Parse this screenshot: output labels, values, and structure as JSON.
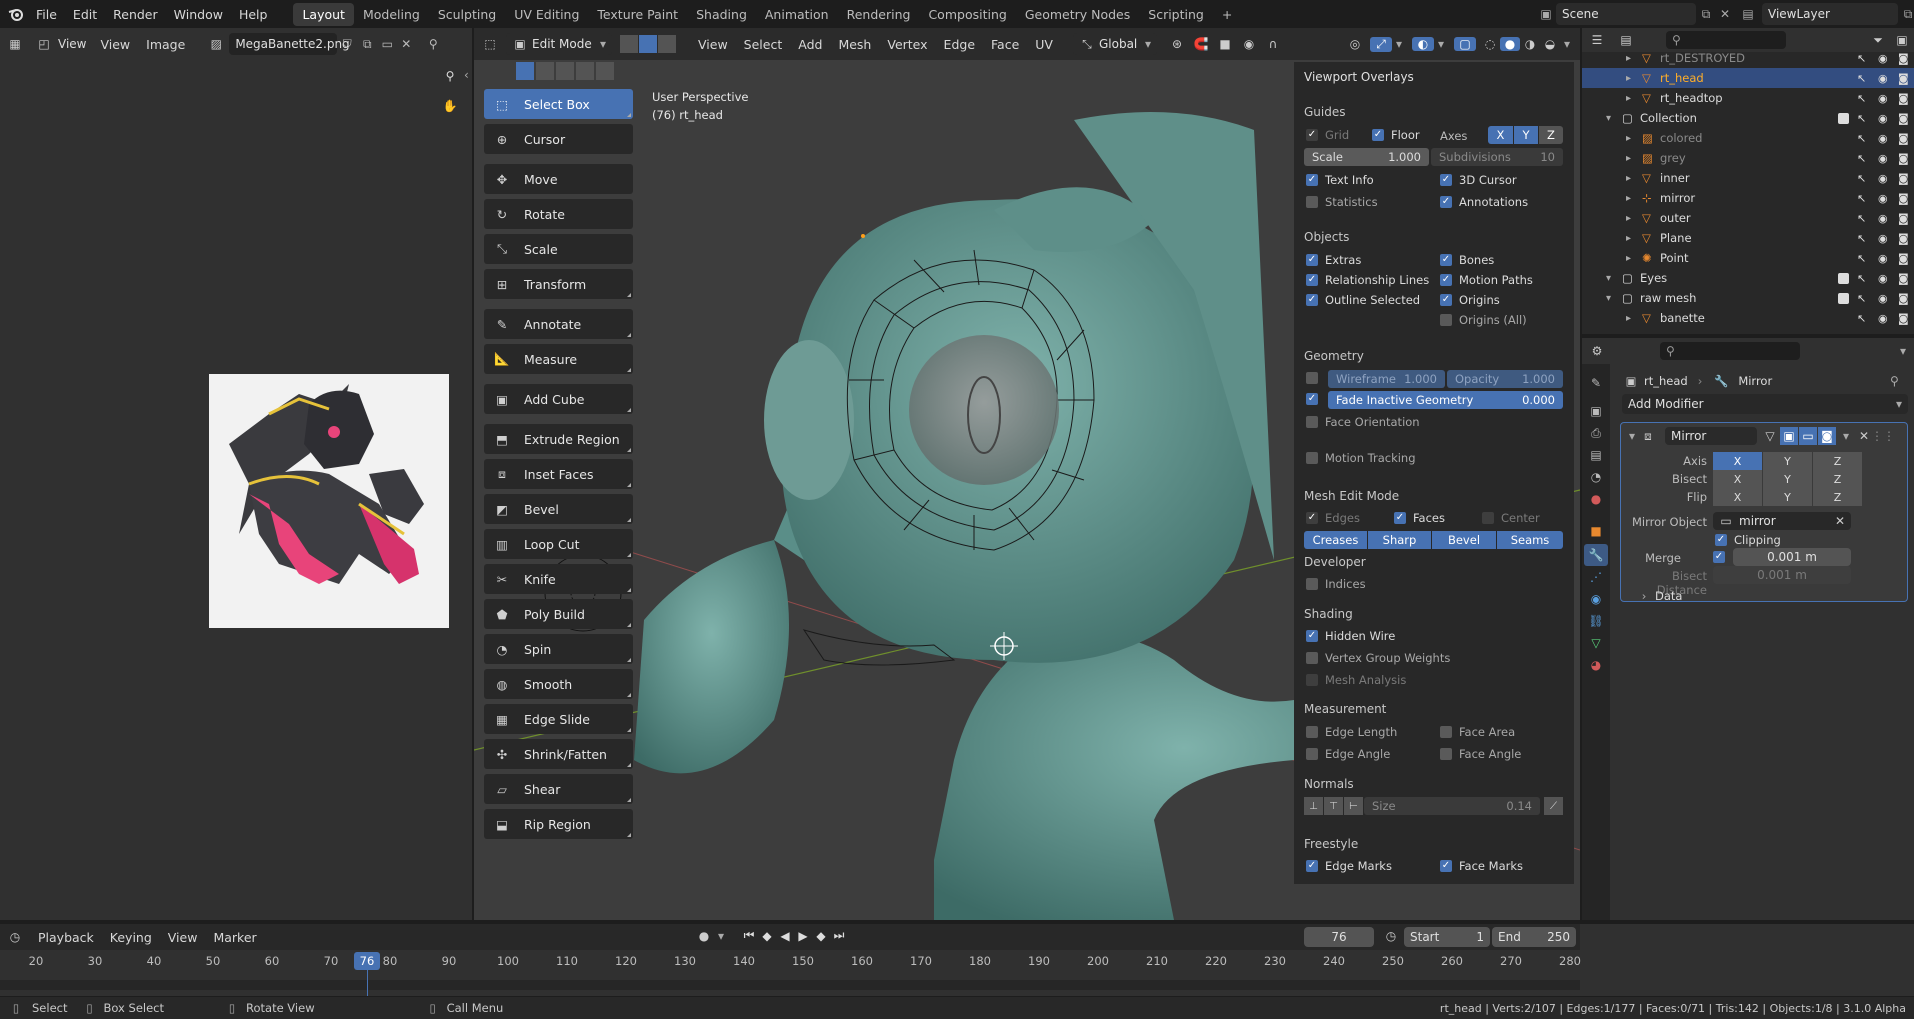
{
  "menu": {
    "file": "File",
    "edit": "Edit",
    "render": "Render",
    "window": "Window",
    "help": "Help"
  },
  "workspaces": [
    "Layout",
    "Modeling",
    "Sculpting",
    "UV Editing",
    "Texture Paint",
    "Shading",
    "Animation",
    "Rendering",
    "Compositing",
    "Geometry Nodes",
    "Scripting"
  ],
  "scene": {
    "scene_name": "Scene",
    "view_layer": "ViewLayer"
  },
  "image_editor": {
    "view": "View",
    "view2": "View",
    "image": "Image",
    "filename": "MegaBanette2.png"
  },
  "viewport_header": {
    "mode": "Edit Mode",
    "view": "View",
    "select": "Select",
    "add": "Add",
    "mesh": "Mesh",
    "vertex": "Vertex",
    "edge": "Edge",
    "face": "Face",
    "uv": "UV",
    "orientation": "Global"
  },
  "viewport_info": {
    "perspective": "User Perspective",
    "object": "(76) rt_head"
  },
  "tools": [
    {
      "label": "Select Box",
      "icon": "select-box-icon",
      "active": true
    },
    {
      "label": "Cursor",
      "icon": "cursor-icon"
    },
    {
      "label": "Move",
      "icon": "move-icon"
    },
    {
      "label": "Rotate",
      "icon": "rotate-icon"
    },
    {
      "label": "Scale",
      "icon": "scale-icon"
    },
    {
      "label": "Transform",
      "icon": "transform-icon"
    },
    {
      "label": "Annotate",
      "icon": "annotate-icon"
    },
    {
      "label": "Measure",
      "icon": "measure-icon"
    },
    {
      "label": "Add Cube",
      "icon": "add-cube-icon"
    },
    {
      "label": "Extrude Region",
      "icon": "extrude-icon"
    },
    {
      "label": "Inset Faces",
      "icon": "inset-icon"
    },
    {
      "label": "Bevel",
      "icon": "bevel-icon"
    },
    {
      "label": "Loop Cut",
      "icon": "loop-cut-icon"
    },
    {
      "label": "Knife",
      "icon": "knife-icon"
    },
    {
      "label": "Poly Build",
      "icon": "poly-build-icon"
    },
    {
      "label": "Spin",
      "icon": "spin-icon"
    },
    {
      "label": "Smooth",
      "icon": "smooth-icon"
    },
    {
      "label": "Edge Slide",
      "icon": "edge-slide-icon"
    },
    {
      "label": "Shrink/Fatten",
      "icon": "shrink-fatten-icon"
    },
    {
      "label": "Shear",
      "icon": "shear-icon"
    },
    {
      "label": "Rip Region",
      "icon": "rip-region-icon"
    }
  ],
  "overlays": {
    "title": "Viewport Overlays",
    "guides": "Guides",
    "grid": "Grid",
    "floor": "Floor",
    "axes": "Axes",
    "ax": "X",
    "ay": "Y",
    "az": "Z",
    "scale_label": "Scale",
    "scale_value": "1.000",
    "subdiv_label": "Subdivisions",
    "subdiv_value": "10",
    "text_info": "Text Info",
    "cursor3d": "3D Cursor",
    "statistics": "Statistics",
    "annotations": "Annotations",
    "objects": "Objects",
    "extras": "Extras",
    "bones": "Bones",
    "relationship_lines": "Relationship Lines",
    "motion_paths": "Motion Paths",
    "outline_selected": "Outline Selected",
    "origins": "Origins",
    "origins_all": "Origins (All)",
    "geometry": "Geometry",
    "wireframe_label": "Wireframe",
    "wireframe_value": "1.000",
    "opacity_label": "Opacity",
    "opacity_value": "1.000",
    "fade_label": "Fade Inactive Geometry",
    "fade_value": "0.000",
    "face_orientation": "Face Orientation",
    "motion_tracking": "Motion Tracking",
    "mesh_edit_mode": "Mesh Edit Mode",
    "edges": "Edges",
    "faces": "Faces",
    "center": "Center",
    "creases": "Creases",
    "sharp": "Sharp",
    "bevel": "Bevel",
    "seams": "Seams",
    "developer": "Developer",
    "indices": "Indices",
    "shading": "Shading",
    "hidden_wire": "Hidden Wire",
    "vertex_group_weights": "Vertex Group Weights",
    "mesh_analysis": "Mesh Analysis",
    "measurement": "Measurement",
    "edge_length": "Edge Length",
    "face_area": "Face Area",
    "edge_angle": "Edge Angle",
    "face_angle": "Face Angle",
    "normals": "Normals",
    "size_label": "Size",
    "size_value": "0.14",
    "freestyle": "Freestyle",
    "edge_marks": "Edge Marks",
    "face_marks": "Face Marks"
  },
  "outliner": [
    {
      "name": "rt_DESTROYED",
      "indent": 2,
      "type": "mesh",
      "dim": true
    },
    {
      "name": "rt_head",
      "indent": 2,
      "type": "mesh",
      "selected": true
    },
    {
      "name": "rt_headtop",
      "indent": 2,
      "type": "mesh"
    },
    {
      "name": "Collection",
      "indent": 1,
      "type": "collection"
    },
    {
      "name": "colored",
      "indent": 2,
      "type": "image",
      "dim": true
    },
    {
      "name": "grey",
      "indent": 2,
      "type": "image",
      "dim": true
    },
    {
      "name": "inner",
      "indent": 2,
      "type": "mesh"
    },
    {
      "name": "mirror",
      "indent": 2,
      "type": "empty"
    },
    {
      "name": "outer",
      "indent": 2,
      "type": "mesh"
    },
    {
      "name": "Plane",
      "indent": 2,
      "type": "mesh"
    },
    {
      "name": "Point",
      "indent": 2,
      "type": "light"
    },
    {
      "name": "Eyes",
      "indent": 1,
      "type": "collection"
    },
    {
      "name": "raw mesh",
      "indent": 1,
      "type": "collection"
    },
    {
      "name": "banette",
      "indent": 2,
      "type": "mesh"
    }
  ],
  "properties": {
    "object": "rt_head",
    "modifier_breadcrumb": "Mirror",
    "add_modifier": "Add Modifier",
    "modifier_name": "Mirror",
    "axis": "Axis",
    "bisect": "Bisect",
    "flip": "Flip",
    "x": "X",
    "y": "Y",
    "z": "Z",
    "mirror_object_label": "Mirror Object",
    "mirror_object": "mirror",
    "clipping": "Clipping",
    "merge_label": "Merge",
    "merge_value": "0.001 m",
    "bisect_distance_label": "Bisect Distance",
    "bisect_distance_value": "0.001 m",
    "data": "Data"
  },
  "timeline": {
    "playback": "Playback",
    "keying": "Keying",
    "view": "View",
    "marker": "Marker",
    "current_frame": "76",
    "start_label": "Start",
    "start": "1",
    "end_label": "End",
    "end": "250",
    "ticks": [
      "20",
      "30",
      "40",
      "50",
      "60",
      "70",
      "80",
      "90",
      "100",
      "110",
      "120",
      "130",
      "140",
      "150",
      "160",
      "170",
      "180",
      "190",
      "200",
      "210",
      "220",
      "230",
      "240",
      "250",
      "260",
      "270",
      "280"
    ]
  },
  "statusbar": {
    "select": "Select",
    "box_select": "Box Select",
    "rotate_view": "Rotate View",
    "call_menu": "Call Menu",
    "stats": "rt_head | Verts:2/107 | Edges:1/177 | Faces:0/71 | Tris:142 | Objects:1/8 | 3.1.0 Alpha"
  }
}
